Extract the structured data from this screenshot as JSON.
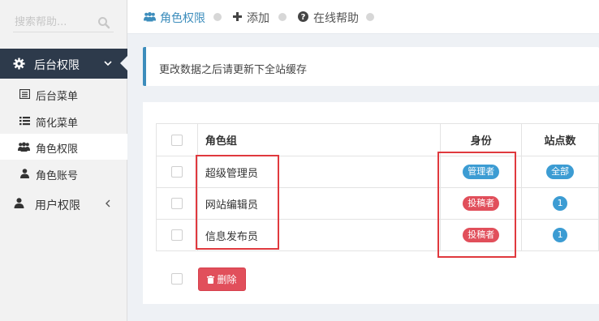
{
  "sidebar": {
    "search_placeholder": "搜索帮助...",
    "group_label": "后台权限",
    "items": [
      {
        "label": "后台菜单",
        "icon": "list-alt-icon"
      },
      {
        "label": "简化菜单",
        "icon": "list-icon"
      },
      {
        "label": "角色权限",
        "icon": "users-icon"
      },
      {
        "label": "角色账号",
        "icon": "user-icon"
      }
    ],
    "active_item": "角色权限",
    "user_perm_label": "用户权限"
  },
  "breadcrumb": {
    "items": [
      {
        "label": "角色权限",
        "icon": "users-icon"
      },
      {
        "label": "添加",
        "icon": "plus-icon"
      },
      {
        "label": "在线帮助",
        "icon": "question-circle-icon"
      }
    ]
  },
  "alert": {
    "text": "更改数据之后请更新下全站缓存"
  },
  "table": {
    "headers": {
      "name": "角色组",
      "identity": "身份",
      "sites": "站点数"
    },
    "rows": [
      {
        "name": "超级管理员",
        "identity": "管理者",
        "identity_color": "#3c9cd3",
        "sites": "全部"
      },
      {
        "name": "网站编辑员",
        "identity": "投稿者",
        "identity_color": "#e14f5b",
        "sites": "1"
      },
      {
        "name": "信息发布员",
        "identity": "投稿者",
        "identity_color": "#e14f5b",
        "sites": "1"
      }
    ]
  },
  "actions": {
    "delete_label": "删除"
  },
  "colors": {
    "accent": "#3c8dbc",
    "sidebar_active_bg": "#2d3a4b",
    "danger": "#e14f5b",
    "annotation": "#e0393e"
  }
}
